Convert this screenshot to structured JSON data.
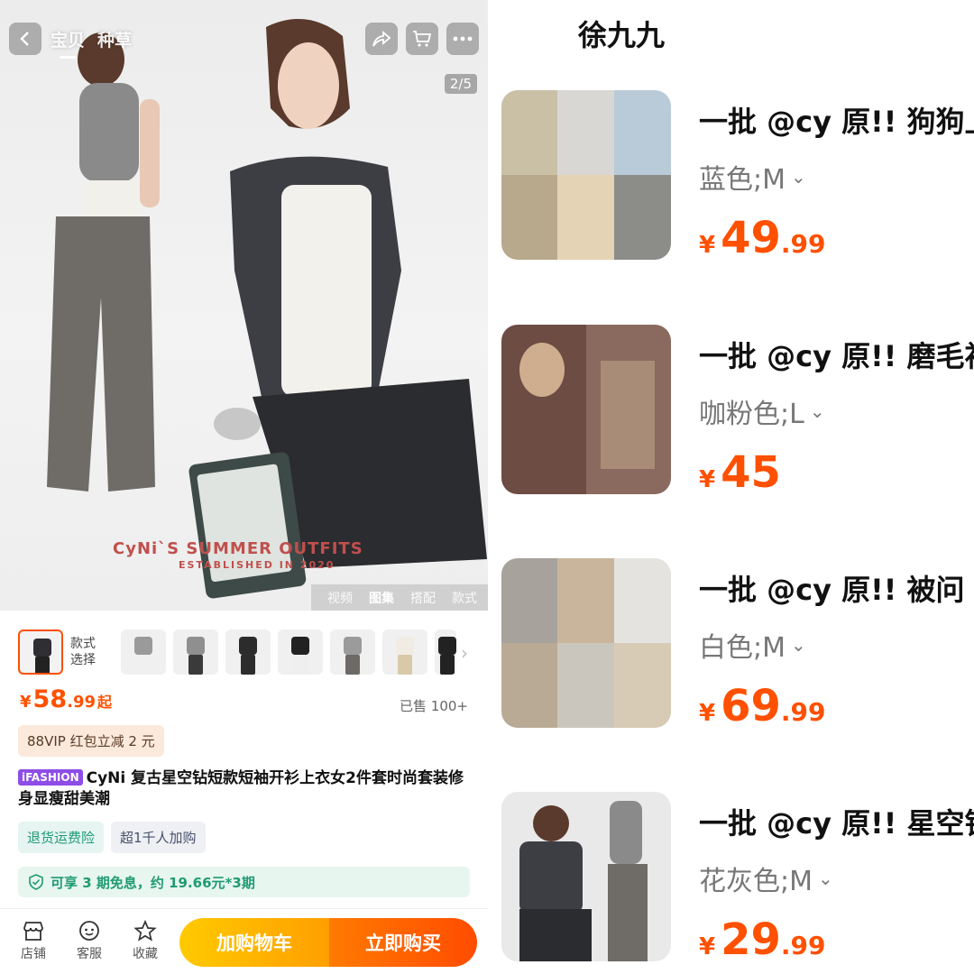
{
  "product_page": {
    "nav_tabs": [
      "宝贝",
      "种草"
    ],
    "image_counter": "2/5",
    "hero_brand_text": "CyNi`S SUMMER OUTFITS",
    "hero_brand_sub": "ESTABLISHED IN 2020",
    "media_tabs": [
      "视频",
      "图集",
      "搭配",
      "款式"
    ],
    "variant_label": "款式\n选择",
    "price": {
      "currency": "¥",
      "integer": "58",
      "decimal": ".99",
      "suffix": "起"
    },
    "sold": "已售 100+",
    "vip_badge": "88VIP 红包立减 2 元",
    "ifashion_badge": "iFASHION",
    "title": "CyNi 复古星空钻短款短袖开衫上衣女2件套时尚套装修身显瘦甜美潮",
    "tags": [
      "退货运费险",
      "超1千人加购"
    ],
    "installment": "可享 3 期免息，约 19.66元*3期",
    "bottom_bar": {
      "shop": "店铺",
      "service": "客服",
      "favorite": "收藏",
      "add_to_cart": "加购物车",
      "buy_now": "立即购买"
    }
  },
  "shop": {
    "name": "徐九九",
    "items": [
      {
        "title": "一批 @cy 原!!  狗狗上",
        "variant": "蓝色;M",
        "price": {
          "currency": "¥",
          "integer": "49",
          "decimal": ".99"
        }
      },
      {
        "title": "一批 @cy 原!!  磨毛衬",
        "variant": "咖粉色;L",
        "price": {
          "currency": "¥",
          "integer": "45",
          "decimal": ""
        }
      },
      {
        "title": "一批 @cy 原!! 被问 N",
        "variant": "白色;M",
        "price": {
          "currency": "¥",
          "integer": "69",
          "decimal": ".99"
        }
      },
      {
        "title": "一批 @cy 原!!  星空钻",
        "variant": "花灰色;M",
        "price": {
          "currency": "¥",
          "integer": "29",
          "decimal": ".99"
        }
      }
    ]
  },
  "colors": {
    "accent": "#ff5000",
    "green": "#1f9b73",
    "cart_yellow": "#ffb000",
    "buy_orange": "#ff5a00"
  }
}
